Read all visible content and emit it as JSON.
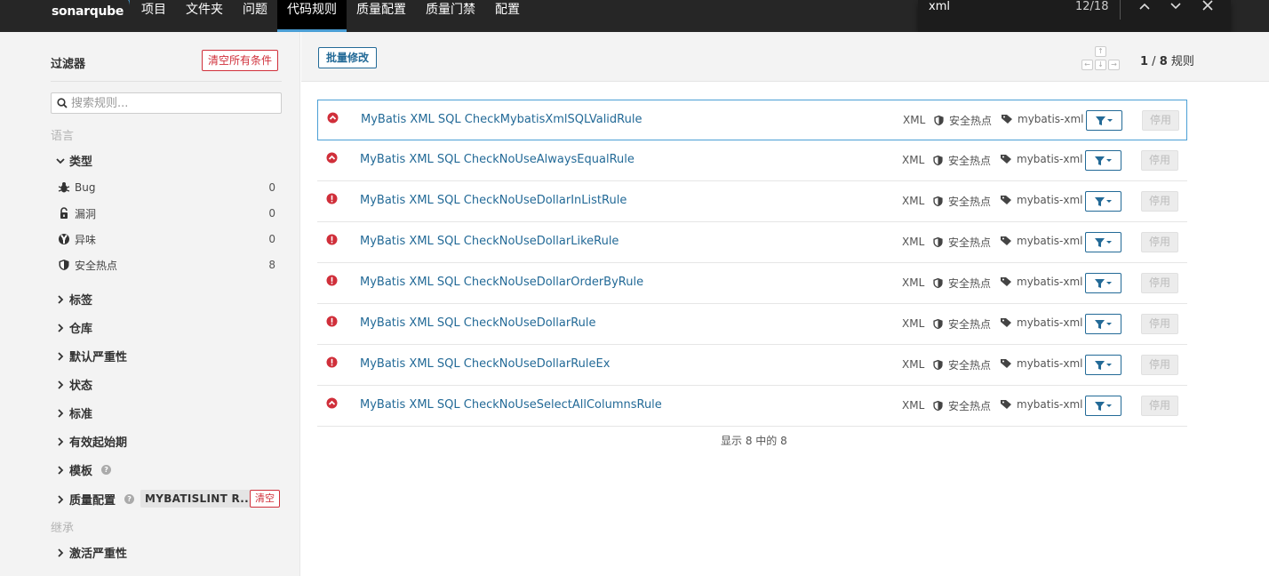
{
  "nav": {
    "logo": "sonarqube",
    "items": [
      "项目",
      "文件夹",
      "问题",
      "代码规则",
      "质量配置",
      "质量门禁",
      "配置"
    ],
    "active_index": 3
  },
  "find_bar": {
    "query": "xml",
    "count": "12/18"
  },
  "sidebar": {
    "title": "过滤器",
    "clear_all": "清空所有条件",
    "search_placeholder": "搜索规则...",
    "section_language": "语言",
    "type_facet": "类型",
    "types": [
      {
        "label": "Bug",
        "count": "0",
        "icon": "bug-icon"
      },
      {
        "label": "漏洞",
        "count": "0",
        "icon": "lock-icon"
      },
      {
        "label": "异味",
        "count": "0",
        "icon": "code-smell-icon"
      },
      {
        "label": "安全热点",
        "count": "8",
        "icon": "shield-icon"
      }
    ],
    "facets": [
      "标签",
      "仓库",
      "默认严重性",
      "状态",
      "标准",
      "有效起始期",
      "模板",
      "质量配置"
    ],
    "quality_profile_tag": "MYBATISLINT R...",
    "quality_profile_clear": "清空",
    "section_inheritance": "继承",
    "activation_severity": "激活严重性"
  },
  "main": {
    "bulk_change": "批量修改",
    "rule_count": {
      "current": "1",
      "separator": " / ",
      "total": "8",
      "unit": "规则"
    },
    "footer": "显示 8 中的 8",
    "rules": [
      {
        "name": "MyBatis XML SQL CheckMybatisXmlSQLValidRule",
        "severity": "major",
        "lang": "XML",
        "type": "安全热点",
        "tag": "mybatis-xml",
        "action": "停用"
      },
      {
        "name": "MyBatis XML SQL CheckNoUseAlwaysEqualRule",
        "severity": "major",
        "lang": "XML",
        "type": "安全热点",
        "tag": "mybatis-xml",
        "action": "停用"
      },
      {
        "name": "MyBatis XML SQL CheckNoUseDollarInListRule",
        "severity": "blocker",
        "lang": "XML",
        "type": "安全热点",
        "tag": "mybatis-xml",
        "action": "停用"
      },
      {
        "name": "MyBatis XML SQL CheckNoUseDollarLikeRule",
        "severity": "blocker",
        "lang": "XML",
        "type": "安全热点",
        "tag": "mybatis-xml",
        "action": "停用"
      },
      {
        "name": "MyBatis XML SQL CheckNoUseDollarOrderByRule",
        "severity": "blocker",
        "lang": "XML",
        "type": "安全热点",
        "tag": "mybatis-xml",
        "action": "停用"
      },
      {
        "name": "MyBatis XML SQL CheckNoUseDollarRule",
        "severity": "blocker",
        "lang": "XML",
        "type": "安全热点",
        "tag": "mybatis-xml",
        "action": "停用"
      },
      {
        "name": "MyBatis XML SQL CheckNoUseDollarRuleEx",
        "severity": "blocker",
        "lang": "XML",
        "type": "安全热点",
        "tag": "mybatis-xml",
        "action": "停用"
      },
      {
        "name": "MyBatis XML SQL CheckNoUseSelectAllColumnsRule",
        "severity": "major",
        "lang": "XML",
        "type": "安全热点",
        "tag": "mybatis-xml",
        "action": "停用"
      }
    ]
  },
  "colors": {
    "accent": "#4b9fd5",
    "link": "#236a97",
    "danger": "#d02f3a",
    "nav_bg": "#262626"
  }
}
